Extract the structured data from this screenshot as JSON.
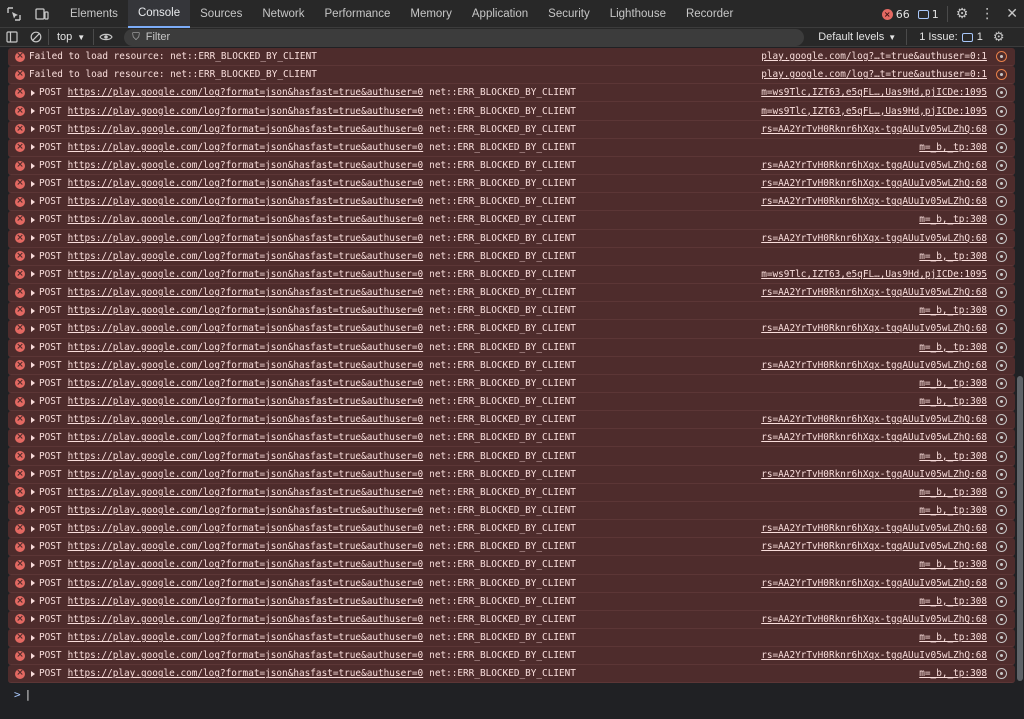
{
  "tabs": [
    {
      "label": "Elements",
      "active": false
    },
    {
      "label": "Console",
      "active": true
    },
    {
      "label": "Sources",
      "active": false
    },
    {
      "label": "Network",
      "active": false
    },
    {
      "label": "Performance",
      "active": false
    },
    {
      "label": "Memory",
      "active": false
    },
    {
      "label": "Application",
      "active": false
    },
    {
      "label": "Security",
      "active": false
    },
    {
      "label": "Lighthouse",
      "active": false
    },
    {
      "label": "Recorder",
      "active": false
    }
  ],
  "status": {
    "errors": "66",
    "messages": "1"
  },
  "toolbar": {
    "context": "top",
    "filter_placeholder": "Filter",
    "levels": "Default levels",
    "issues_label": "1 Issue:",
    "issues_count": "1"
  },
  "colors": {
    "error_bg": "#4e2c2c",
    "accent": "#7cacf8",
    "error_icon": "#e46962"
  },
  "log": [
    {
      "type": "plain",
      "message": "Failed to load resource: net::ERR_BLOCKED_BY_CLIENT",
      "source": "play.google.com/log?…t=true&authuser=0:1",
      "icon": "orange"
    },
    {
      "type": "plain",
      "message": "Failed to load resource: net::ERR_BLOCKED_BY_CLIENT",
      "source": "play.google.com/log?…t=true&authuser=0:1",
      "icon": "orange"
    },
    {
      "type": "post",
      "method": "POST",
      "url": "https://play.google.com/log?format=json&hasfast=true&authuser=0",
      "error": "net::ERR_BLOCKED_BY_CLIENT",
      "source": "m=ws9Tlc,IZT63,e5qFL…,Uas9Hd,pjICDe:1095"
    },
    {
      "type": "post",
      "method": "POST",
      "url": "https://play.google.com/log?format=json&hasfast=true&authuser=0",
      "error": "net::ERR_BLOCKED_BY_CLIENT",
      "source": "m=ws9Tlc,IZT63,e5qFL…,Uas9Hd,pjICDe:1095"
    },
    {
      "type": "post",
      "method": "POST",
      "url": "https://play.google.com/log?format=json&hasfast=true&authuser=0",
      "error": "net::ERR_BLOCKED_BY_CLIENT",
      "source": "rs=AA2YrTvH0Rknr6hXqx-tgqAUuIv05wLZhQ:68"
    },
    {
      "type": "post",
      "method": "POST",
      "url": "https://play.google.com/log?format=json&hasfast=true&authuser=0",
      "error": "net::ERR_BLOCKED_BY_CLIENT",
      "source": "m=_b,_tp:308"
    },
    {
      "type": "post",
      "method": "POST",
      "url": "https://play.google.com/log?format=json&hasfast=true&authuser=0",
      "error": "net::ERR_BLOCKED_BY_CLIENT",
      "source": "rs=AA2YrTvH0Rknr6hXqx-tgqAUuIv05wLZhQ:68"
    },
    {
      "type": "post",
      "method": "POST",
      "url": "https://play.google.com/log?format=json&hasfast=true&authuser=0",
      "error": "net::ERR_BLOCKED_BY_CLIENT",
      "source": "rs=AA2YrTvH0Rknr6hXqx-tgqAUuIv05wLZhQ:68"
    },
    {
      "type": "post",
      "method": "POST",
      "url": "https://play.google.com/log?format=json&hasfast=true&authuser=0",
      "error": "net::ERR_BLOCKED_BY_CLIENT",
      "source": "rs=AA2YrTvH0Rknr6hXqx-tgqAUuIv05wLZhQ:68"
    },
    {
      "type": "post",
      "method": "POST",
      "url": "https://play.google.com/log?format=json&hasfast=true&authuser=0",
      "error": "net::ERR_BLOCKED_BY_CLIENT",
      "source": "m=_b,_tp:308"
    },
    {
      "type": "post",
      "method": "POST",
      "url": "https://play.google.com/log?format=json&hasfast=true&authuser=0",
      "error": "net::ERR_BLOCKED_BY_CLIENT",
      "source": "rs=AA2YrTvH0Rknr6hXqx-tgqAUuIv05wLZhQ:68"
    },
    {
      "type": "post",
      "method": "POST",
      "url": "https://play.google.com/log?format=json&hasfast=true&authuser=0",
      "error": "net::ERR_BLOCKED_BY_CLIENT",
      "source": "m=_b,_tp:308"
    },
    {
      "type": "post",
      "method": "POST",
      "url": "https://play.google.com/log?format=json&hasfast=true&authuser=0",
      "error": "net::ERR_BLOCKED_BY_CLIENT",
      "source": "m=ws9Tlc,IZT63,e5qFL…,Uas9Hd,pjICDe:1095"
    },
    {
      "type": "post",
      "method": "POST",
      "url": "https://play.google.com/log?format=json&hasfast=true&authuser=0",
      "error": "net::ERR_BLOCKED_BY_CLIENT",
      "source": "rs=AA2YrTvH0Rknr6hXqx-tgqAUuIv05wLZhQ:68"
    },
    {
      "type": "post",
      "method": "POST",
      "url": "https://play.google.com/log?format=json&hasfast=true&authuser=0",
      "error": "net::ERR_BLOCKED_BY_CLIENT",
      "source": "m=_b,_tp:308"
    },
    {
      "type": "post",
      "method": "POST",
      "url": "https://play.google.com/log?format=json&hasfast=true&authuser=0",
      "error": "net::ERR_BLOCKED_BY_CLIENT",
      "source": "rs=AA2YrTvH0Rknr6hXqx-tgqAUuIv05wLZhQ:68"
    },
    {
      "type": "post",
      "method": "POST",
      "url": "https://play.google.com/log?format=json&hasfast=true&authuser=0",
      "error": "net::ERR_BLOCKED_BY_CLIENT",
      "source": "m=_b,_tp:308"
    },
    {
      "type": "post",
      "method": "POST",
      "url": "https://play.google.com/log?format=json&hasfast=true&authuser=0",
      "error": "net::ERR_BLOCKED_BY_CLIENT",
      "source": "rs=AA2YrTvH0Rknr6hXqx-tgqAUuIv05wLZhQ:68"
    },
    {
      "type": "post",
      "method": "POST",
      "url": "https://play.google.com/log?format=json&hasfast=true&authuser=0",
      "error": "net::ERR_BLOCKED_BY_CLIENT",
      "source": "m=_b,_tp:308"
    },
    {
      "type": "post",
      "method": "POST",
      "url": "https://play.google.com/log?format=json&hasfast=true&authuser=0",
      "error": "net::ERR_BLOCKED_BY_CLIENT",
      "source": "m=_b,_tp:308"
    },
    {
      "type": "post",
      "method": "POST",
      "url": "https://play.google.com/log?format=json&hasfast=true&authuser=0",
      "error": "net::ERR_BLOCKED_BY_CLIENT",
      "source": "rs=AA2YrTvH0Rknr6hXqx-tgqAUuIv05wLZhQ:68"
    },
    {
      "type": "post",
      "method": "POST",
      "url": "https://play.google.com/log?format=json&hasfast=true&authuser=0",
      "error": "net::ERR_BLOCKED_BY_CLIENT",
      "source": "rs=AA2YrTvH0Rknr6hXqx-tgqAUuIv05wLZhQ:68"
    },
    {
      "type": "post",
      "method": "POST",
      "url": "https://play.google.com/log?format=json&hasfast=true&authuser=0",
      "error": "net::ERR_BLOCKED_BY_CLIENT",
      "source": "m=_b,_tp:308"
    },
    {
      "type": "post",
      "method": "POST",
      "url": "https://play.google.com/log?format=json&hasfast=true&authuser=0",
      "error": "net::ERR_BLOCKED_BY_CLIENT",
      "source": "rs=AA2YrTvH0Rknr6hXqx-tgqAUuIv05wLZhQ:68"
    },
    {
      "type": "post",
      "method": "POST",
      "url": "https://play.google.com/log?format=json&hasfast=true&authuser=0",
      "error": "net::ERR_BLOCKED_BY_CLIENT",
      "source": "m=_b,_tp:308"
    },
    {
      "type": "post",
      "method": "POST",
      "url": "https://play.google.com/log?format=json&hasfast=true&authuser=0",
      "error": "net::ERR_BLOCKED_BY_CLIENT",
      "source": "m=_b,_tp:308"
    },
    {
      "type": "post",
      "method": "POST",
      "url": "https://play.google.com/log?format=json&hasfast=true&authuser=0",
      "error": "net::ERR_BLOCKED_BY_CLIENT",
      "source": "rs=AA2YrTvH0Rknr6hXqx-tgqAUuIv05wLZhQ:68"
    },
    {
      "type": "post",
      "method": "POST",
      "url": "https://play.google.com/log?format=json&hasfast=true&authuser=0",
      "error": "net::ERR_BLOCKED_BY_CLIENT",
      "source": "rs=AA2YrTvH0Rknr6hXqx-tgqAUuIv05wLZhQ:68"
    },
    {
      "type": "post",
      "method": "POST",
      "url": "https://play.google.com/log?format=json&hasfast=true&authuser=0",
      "error": "net::ERR_BLOCKED_BY_CLIENT",
      "source": "m=_b,_tp:308"
    },
    {
      "type": "post",
      "method": "POST",
      "url": "https://play.google.com/log?format=json&hasfast=true&authuser=0",
      "error": "net::ERR_BLOCKED_BY_CLIENT",
      "source": "rs=AA2YrTvH0Rknr6hXqx-tgqAUuIv05wLZhQ:68"
    },
    {
      "type": "post",
      "method": "POST",
      "url": "https://play.google.com/log?format=json&hasfast=true&authuser=0",
      "error": "net::ERR_BLOCKED_BY_CLIENT",
      "source": "m=_b,_tp:308"
    },
    {
      "type": "post",
      "method": "POST",
      "url": "https://play.google.com/log?format=json&hasfast=true&authuser=0",
      "error": "net::ERR_BLOCKED_BY_CLIENT",
      "source": "rs=AA2YrTvH0Rknr6hXqx-tgqAUuIv05wLZhQ:68"
    },
    {
      "type": "post",
      "method": "POST",
      "url": "https://play.google.com/log?format=json&hasfast=true&authuser=0",
      "error": "net::ERR_BLOCKED_BY_CLIENT",
      "source": "m=_b,_tp:308"
    },
    {
      "type": "post",
      "method": "POST",
      "url": "https://play.google.com/log?format=json&hasfast=true&authuser=0",
      "error": "net::ERR_BLOCKED_BY_CLIENT",
      "source": "rs=AA2YrTvH0Rknr6hXqx-tgqAUuIv05wLZhQ:68"
    },
    {
      "type": "post",
      "method": "POST",
      "url": "https://play.google.com/log?format=json&hasfast=true&authuser=0",
      "error": "net::ERR_BLOCKED_BY_CLIENT",
      "source": "m=_b,_tp:308"
    }
  ],
  "prompt_symbol": ">"
}
